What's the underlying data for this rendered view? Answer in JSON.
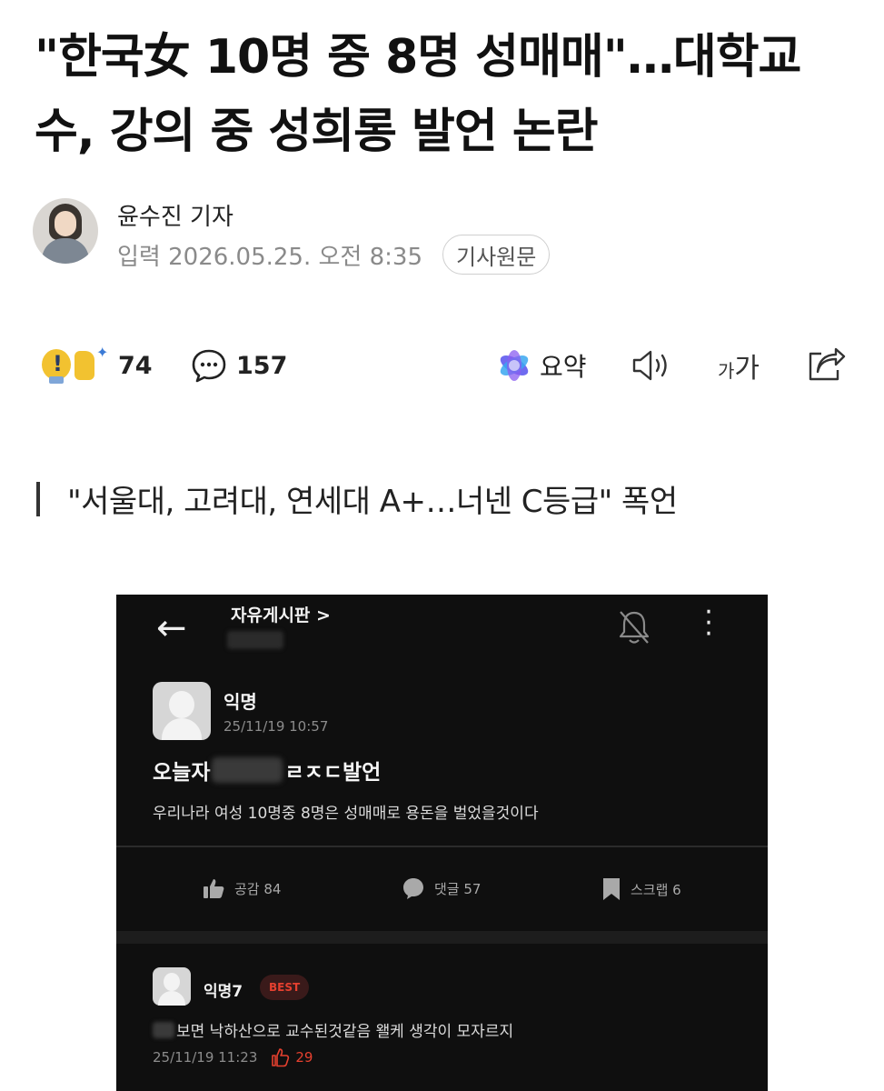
{
  "article": {
    "headline": "\"한국女 10명 중 8명 성매매\"…대학교수, 강의 중 성희롱 발언 논란",
    "reporter": "윤수진 기자",
    "published": "입력 2026.05.25. 오전 8:35",
    "origin_button": "기사원문",
    "subhead": "\"서울대, 고려대, 연세대 A+…너넨 C등급\" 폭언"
  },
  "actions": {
    "reactions_count": "74",
    "comments_count": "157",
    "summary_label": "요약",
    "font_small": "가",
    "font_large": "가"
  },
  "screenshot": {
    "board_name": "자유게시판 >",
    "post": {
      "author": "익명",
      "time": "25/11/19 10:57",
      "title_prefix": "오늘자",
      "title_suffix": "ㄹㅈㄷ발언",
      "body": "우리나라 여성 10명중 8명은 성매매로 용돈을 벌었을것이다"
    },
    "stats": {
      "likes": "공감 84",
      "comments": "댓글 57",
      "scraps": "스크랩 6"
    },
    "comment": {
      "author": "익명7",
      "badge": "BEST",
      "body": "보면 낙하산으로 교수된것같음 왤케 생각이 모자르지",
      "time": "25/11/19 11:23",
      "likes": "29"
    }
  },
  "colors": {
    "screenshot_bg": "#0f0f0f",
    "best_red": "#e5402f",
    "reaction_yellow": "#f2c230"
  }
}
